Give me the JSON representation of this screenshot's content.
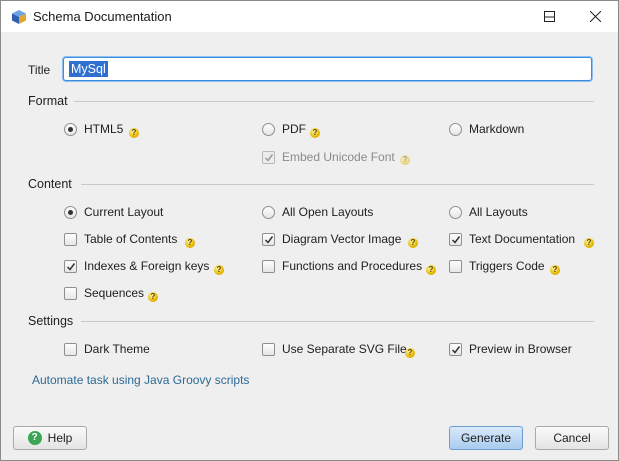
{
  "window": {
    "title": "Schema Documentation",
    "icon": "dbschema-app-icon",
    "controls": [
      "minimize-icon",
      "maximize-icon",
      "close-icon"
    ]
  },
  "title_field": {
    "label": "Title",
    "value": "MySql"
  },
  "format": {
    "section_label": "Format",
    "options": [
      {
        "label": "HTML5",
        "selected": true,
        "has_help": true
      },
      {
        "label": "PDF",
        "selected": false,
        "has_help": true
      },
      {
        "label": "Markdown",
        "selected": false,
        "has_help": false
      }
    ],
    "embed_unicode_font": {
      "label": "Embed Unicode Font",
      "checked": true,
      "enabled": false
    }
  },
  "content": {
    "section_label": "Content",
    "layout_options": [
      {
        "label": "Current Layout",
        "selected": true
      },
      {
        "label": "All Open Layouts",
        "selected": false
      },
      {
        "label": "All Layouts",
        "selected": false
      }
    ],
    "checkboxes": [
      {
        "label": "Table of Contents",
        "checked": false
      },
      {
        "label": "Diagram Vector Image",
        "checked": true
      },
      {
        "label": "Text Documentation",
        "checked": true
      },
      {
        "label": "Indexes & Foreign keys",
        "checked": true
      },
      {
        "label": "Functions and Procedures",
        "checked": false
      },
      {
        "label": "Triggers Code",
        "checked": false
      },
      {
        "label": "Sequences",
        "checked": false
      }
    ]
  },
  "settings": {
    "section_label": "Settings",
    "checkboxes": [
      {
        "label": "Dark Theme",
        "checked": false
      },
      {
        "label": "Use Separate SVG File",
        "checked": false
      },
      {
        "label": "Preview in Browser",
        "checked": true
      }
    ]
  },
  "automate_link": "Automate task using Java Groovy scripts",
  "buttons": {
    "help": "Help",
    "generate": "Generate",
    "cancel": "Cancel"
  },
  "colors": {
    "accent": "#2f6fd0",
    "link": "#2b6a94",
    "primary_button": "#a9cbee",
    "help_icon": "#3aa655"
  }
}
